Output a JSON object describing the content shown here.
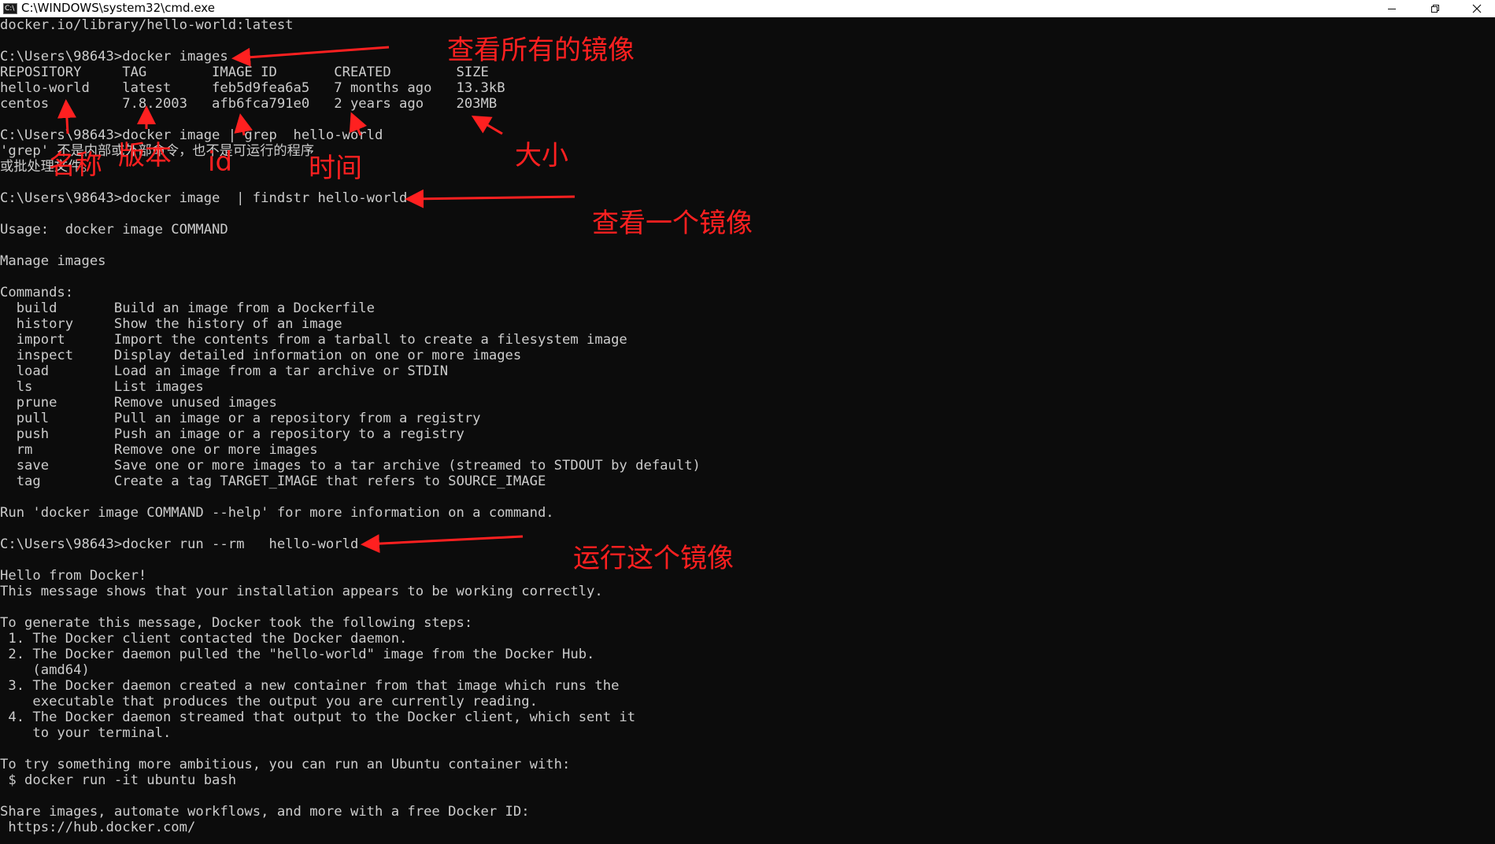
{
  "window": {
    "title": "C:\\WINDOWS\\system32\\cmd.exe",
    "icon": "cmd-icon",
    "controls": {
      "minimize_icon": "minimize-icon",
      "maximize_icon": "restore-icon",
      "close_icon": "close-icon"
    }
  },
  "colors": {
    "console_bg": "#0c0c0c",
    "console_fg": "#cccccc",
    "annotation": "#ff2020",
    "titlebar_bg": "#ffffff"
  },
  "console": {
    "lines": [
      "docker.io/library/hello-world:latest",
      "",
      "C:\\Users\\98643>docker images",
      "REPOSITORY     TAG        IMAGE ID       CREATED        SIZE",
      "hello-world    latest     feb5d9fea6a5   7 months ago   13.3kB",
      "centos         7.8.2003   afb6fca791e0   2 years ago    203MB",
      "",
      "C:\\Users\\98643>docker image | grep  hello-world",
      "'grep' 不是内部或外部命令，也不是可运行的程序",
      "或批处理文件。",
      "",
      "C:\\Users\\98643>docker image  | findstr hello-world",
      "",
      "Usage:  docker image COMMAND",
      "",
      "Manage images",
      "",
      "Commands:",
      "  build       Build an image from a Dockerfile",
      "  history     Show the history of an image",
      "  import      Import the contents from a tarball to create a filesystem image",
      "  inspect     Display detailed information on one or more images",
      "  load        Load an image from a tar archive or STDIN",
      "  ls          List images",
      "  prune       Remove unused images",
      "  pull        Pull an image or a repository from a registry",
      "  push        Push an image or a repository to a registry",
      "  rm          Remove one or more images",
      "  save        Save one or more images to a tar archive (streamed to STDOUT by default)",
      "  tag         Create a tag TARGET_IMAGE that refers to SOURCE_IMAGE",
      "",
      "Run 'docker image COMMAND --help' for more information on a command.",
      "",
      "C:\\Users\\98643>docker run --rm   hello-world",
      "",
      "Hello from Docker!",
      "This message shows that your installation appears to be working correctly.",
      "",
      "To generate this message, Docker took the following steps:",
      " 1. The Docker client contacted the Docker daemon.",
      " 2. The Docker daemon pulled the \"hello-world\" image from the Docker Hub.",
      "    (amd64)",
      " 3. The Docker daemon created a new container from that image which runs the",
      "    executable that produces the output you are currently reading.",
      " 4. The Docker daemon streamed that output to the Docker client, which sent it",
      "    to your terminal.",
      "",
      "To try something more ambitious, you can run an Ubuntu container with:",
      " $ docker run -it ubuntu bash",
      "",
      "Share images, automate workflows, and more with a free Docker ID:",
      " https://hub.docker.com/"
    ]
  },
  "annotations": {
    "view_all_images": "查看所有的镜像",
    "name": "名称",
    "version": "版本",
    "id": "id",
    "time": "时间",
    "size": "大小",
    "view_one_image": "查看一个镜像",
    "run_image": "运行这个镜像"
  }
}
